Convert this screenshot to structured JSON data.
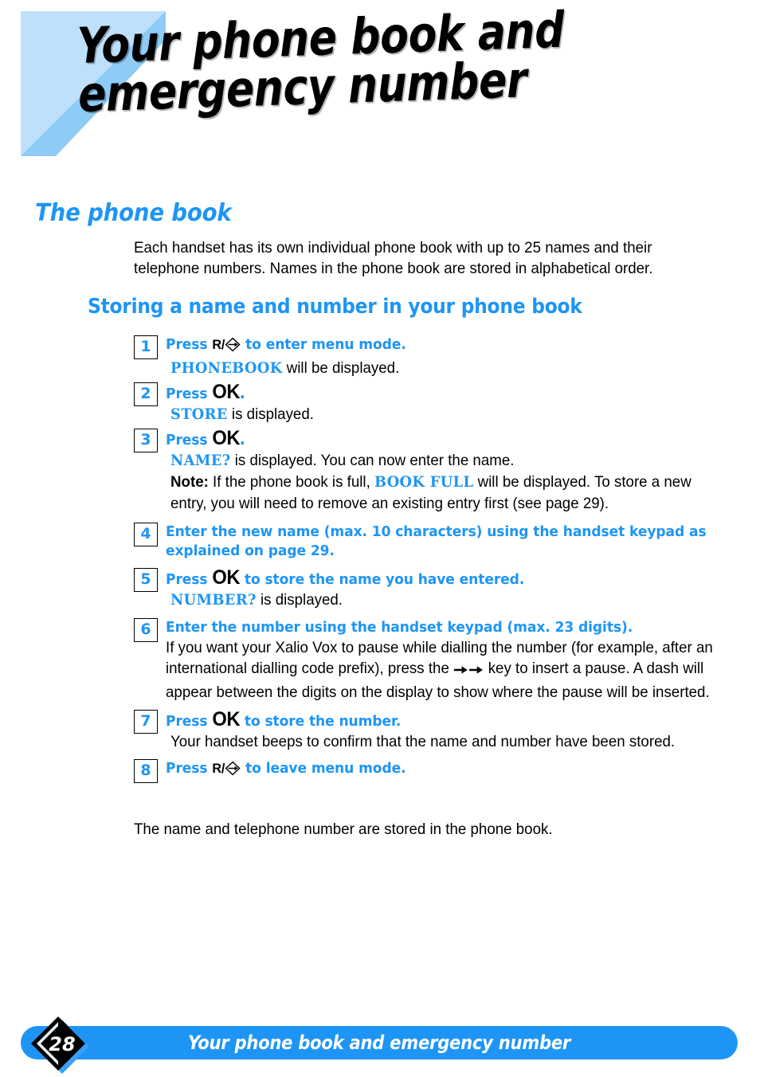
{
  "page": {
    "title": "Your phone book and\nemergency number",
    "number": "28",
    "footer_title": "Your phone book and emergency number"
  },
  "section": {
    "heading": "The phone book",
    "intro": "Each handset has its own individual phone book with up to 25 names and their telephone numbers.  Names in the phone book are stored in alphabetical order.",
    "sub_heading": "Storing a name and number in your phone book",
    "closing": "The name and telephone number are stored in the phone book."
  },
  "steps": [
    {
      "num": "1",
      "lead_pre": "Press",
      "key_icon": "r-menu-key-icon",
      "key_letter": "R/",
      "lead_post": "to enter menu mode.",
      "display_token": "PHONEBOOK",
      "detail": "will be displayed."
    },
    {
      "num": "2",
      "lead_pre": "Press",
      "ok_glyph": "OK",
      "lead_post": ".",
      "display_token": "STORE",
      "detail": "is displayed."
    },
    {
      "num": "3",
      "lead_pre": "Press",
      "ok_glyph": "OK",
      "lead_post": ".",
      "display_token": "NAME?",
      "detail": "is displayed.  You can now enter the name.",
      "note_label": "Note:",
      "note_pre": "If the phone book is full,",
      "note_token": "BOOK FULL",
      "note_post": "will be displayed.  To store a new entry, you will need to remove an existing entry first (see page 29)."
    },
    {
      "num": "4",
      "lead_full": "Enter the new name (max. 10 characters) using the handset keypad as explained on page 29."
    },
    {
      "num": "5",
      "lead_pre": "Press",
      "ok_glyph": "OK",
      "lead_post": "to store the name you have entered.",
      "display_token": "NUMBER?",
      "detail": "is displayed."
    },
    {
      "num": "6",
      "lead_full": "Enter the number using the handset keypad (max. 23 digits).",
      "detail_pre": "If you want your Xalio Vox to pause while dialling the number (for example, after an international dialling code prefix), press the",
      "arrow_icon": "double-right-arrow-icon",
      "detail_post": "key to insert a pause.  A dash will appear between the digits on the display to show where the pause will be inserted."
    },
    {
      "num": "7",
      "lead_pre": "Press",
      "ok_glyph": "OK",
      "lead_post": "to store the number.",
      "detail": "Your handset beeps to confirm that the name and number have been stored."
    },
    {
      "num": "8",
      "lead_pre": "Press",
      "key_icon": "r-menu-key-icon",
      "key_letter": "R/",
      "lead_post": "to leave menu mode."
    }
  ],
  "colors": {
    "accent_blue": "#1E95F5",
    "deco_light_blue": "#BFE0FA",
    "deco_mid_blue": "#8ECBF5",
    "text_black": "#000000"
  }
}
